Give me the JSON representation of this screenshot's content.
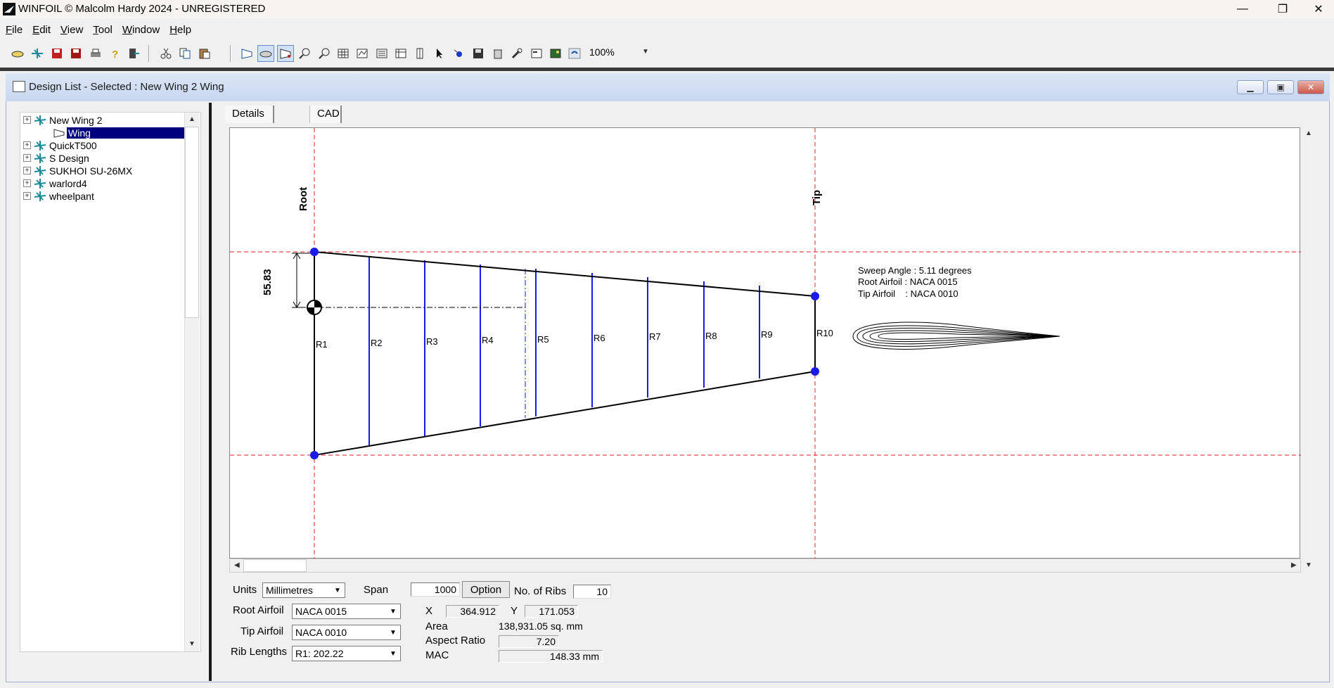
{
  "window": {
    "title": "WINFOIL © Malcolm Hardy 2024 - UNREGISTERED",
    "minimize": "—",
    "restore": "❐",
    "close": "✕"
  },
  "menu": [
    {
      "ul": "F",
      "rest": "ile"
    },
    {
      "ul": "E",
      "rest": "dit"
    },
    {
      "ul": "V",
      "rest": "iew"
    },
    {
      "ul": "T",
      "rest": "ool"
    },
    {
      "ul": "W",
      "rest": "indow"
    },
    {
      "ul": "H",
      "rest": "elp"
    }
  ],
  "toolbar": {
    "zoom": "100%"
  },
  "child": {
    "title": "Design List - Selected : New Wing 2 Wing"
  },
  "tree": {
    "items": [
      {
        "label": "New Wing 2"
      },
      {
        "label": "Wing"
      },
      {
        "label": "QuickT500"
      },
      {
        "label": "S Design"
      },
      {
        "label": "SUKHOI SU-26MX"
      },
      {
        "label": "warlord4"
      },
      {
        "label": "wheelpant"
      }
    ]
  },
  "tabs": {
    "details": "Details",
    "cad": "CAD"
  },
  "cad": {
    "root_label": "Root",
    "tip_label": "Tip",
    "dimension": "55.83",
    "ribs": [
      "R1",
      "R2",
      "R3",
      "R4",
      "R5",
      "R6",
      "R7",
      "R8",
      "R9",
      "R10"
    ],
    "info": {
      "sweep": "Sweep Angle : 5.11 degrees",
      "root_airfoil": "Root Airfoil : NACA 0015",
      "tip_airfoil": "Tip Airfoil    : NACA 0010"
    }
  },
  "form": {
    "units_label": "Units",
    "units_value": "Millimetres",
    "span_label": "Span",
    "span_value": "1000",
    "option_button": "Option",
    "ribs_label": "No. of Ribs",
    "ribs_value": "10",
    "root_airfoil_label": "Root Airfoil",
    "root_airfoil_value": "NACA 0015",
    "tip_airfoil_label": "Tip Airfoil",
    "tip_airfoil_value": "NACA 0010",
    "rib_lengths_label": "Rib Lengths",
    "rib_lengths_value": "R1: 202.22",
    "x_label": "X",
    "x_value": "364.912",
    "y_label": "Y",
    "y_value": "171.053",
    "area_label": "Area",
    "area_value": "138,931.05 sq. mm",
    "aspect_label": "Aspect Ratio",
    "aspect_value": "7.20",
    "mac_label": "MAC",
    "mac_value": "148.33 mm"
  }
}
